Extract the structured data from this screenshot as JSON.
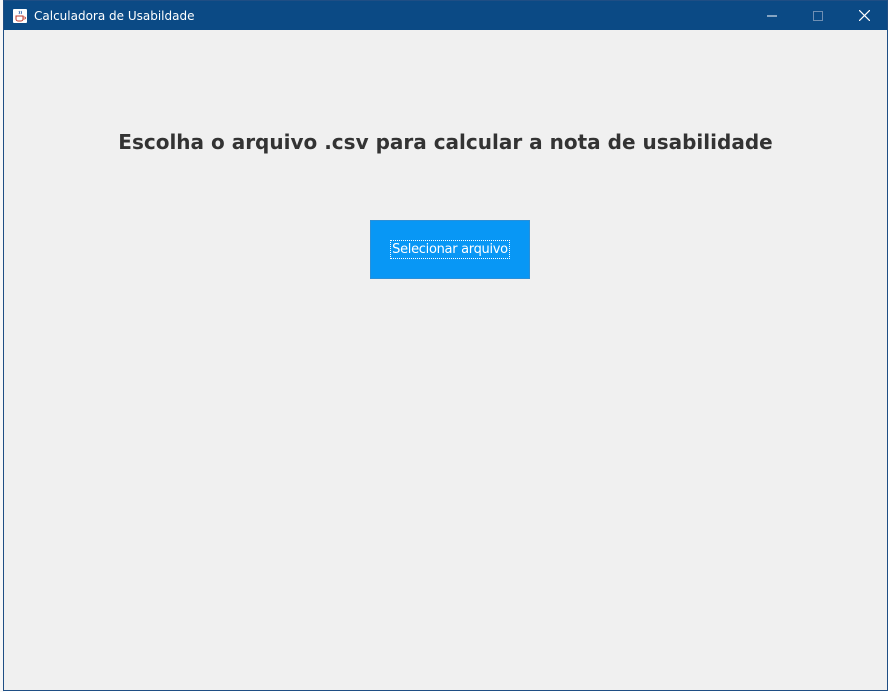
{
  "window": {
    "title": "Calculadora de Usabildade",
    "controls": {
      "minimize_icon": "minimize-icon",
      "maximize_icon": "maximize-icon",
      "close_icon": "close-icon"
    },
    "app_icon": "java-cup-icon"
  },
  "main": {
    "heading": "Escolha o arquivo .csv para calcular a nota de usabilidade",
    "select_button_label": "Selecionar arquivo"
  },
  "colors": {
    "titlebar": "#0b4a85",
    "background": "#f0f0f0",
    "button": "#0897f5",
    "heading_text": "#333333"
  }
}
